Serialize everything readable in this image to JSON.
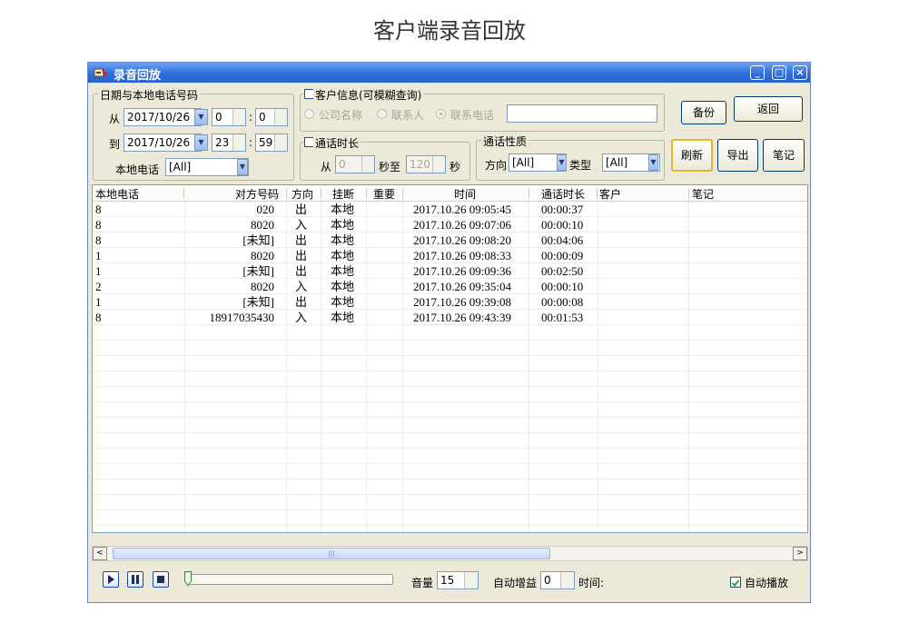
{
  "page_heading": "客户端录音回放",
  "window": {
    "title": "录音回放",
    "controls": {
      "minimize": "_",
      "maximize": "□",
      "close": "×"
    }
  },
  "date_group": {
    "legend": "日期与本地电话号码",
    "from_label": "从",
    "from_date": "2017/10/26 星",
    "from_hour": "0",
    "from_minute": "0",
    "to_label": "到",
    "to_date": "2017/10/26 星",
    "to_hour": "23",
    "to_minute": "59",
    "colon": ":",
    "local_phone_label": "本地电话",
    "local_phone_value": "[All]"
  },
  "customer_group": {
    "legend": "客户信息(可模糊查询)",
    "checked": false,
    "radio_company": "公司名称",
    "radio_contact": "联系人",
    "radio_phone": "联系电话",
    "selected_radio": "联系电话",
    "search_value": ""
  },
  "duration_group": {
    "legend": "通话时长",
    "checked": false,
    "from_label": "从",
    "from_value": "0",
    "mid_label": "秒至",
    "to_value": "120",
    "end_label": "秒"
  },
  "nature_group": {
    "legend": "通话性质",
    "direction_label": "方向",
    "direction_value": "[All]",
    "type_label": "类型",
    "type_value": "[All]"
  },
  "buttons": {
    "backup": "备份",
    "back": "返回",
    "refresh": "刷新",
    "export": "导出",
    "notes": "笔记"
  },
  "table": {
    "columns": [
      "本地电话",
      "对方号码",
      "方向",
      "挂断",
      "重要",
      "时间",
      "通话时长",
      "客户",
      "笔记"
    ],
    "rows": [
      {
        "local": "8",
        "remote": "020",
        "dir": "出",
        "hangup": "本地",
        "important": "",
        "time": "2017.10.26 09:05:45",
        "duration": "00:00:37",
        "customer": "",
        "note": ""
      },
      {
        "local": "8",
        "remote": "8020",
        "dir": "入",
        "hangup": "本地",
        "important": "",
        "time": "2017.10.26 09:07:06",
        "duration": "00:00:10",
        "customer": "",
        "note": ""
      },
      {
        "local": "8",
        "remote": "[未知]",
        "dir": "出",
        "hangup": "本地",
        "important": "",
        "time": "2017.10.26 09:08:20",
        "duration": "00:04:06",
        "customer": "",
        "note": ""
      },
      {
        "local": "1",
        "remote": "8020",
        "dir": "出",
        "hangup": "本地",
        "important": "",
        "time": "2017.10.26 09:08:33",
        "duration": "00:00:09",
        "customer": "",
        "note": ""
      },
      {
        "local": "1",
        "remote": "[未知]",
        "dir": "出",
        "hangup": "本地",
        "important": "",
        "time": "2017.10.26 09:09:36",
        "duration": "00:02:50",
        "customer": "",
        "note": ""
      },
      {
        "local": "2",
        "remote": "8020",
        "dir": "入",
        "hangup": "本地",
        "important": "",
        "time": "2017.10.26 09:35:04",
        "duration": "00:00:10",
        "customer": "",
        "note": ""
      },
      {
        "local": "1",
        "remote": "[未知]",
        "dir": "出",
        "hangup": "本地",
        "important": "",
        "time": "2017.10.26 09:39:08",
        "duration": "00:00:08",
        "customer": "",
        "note": ""
      },
      {
        "local": "8",
        "remote": "18917035430",
        "dir": "入",
        "hangup": "本地",
        "important": "",
        "time": "2017.10.26 09:43:39",
        "duration": "00:01:53",
        "customer": "",
        "note": ""
      }
    ]
  },
  "scrollbar": {
    "left": "<",
    "right": ">",
    "grip": "|||"
  },
  "player": {
    "volume_label": "音量",
    "volume_value": "15",
    "gain_label": "自动增益",
    "gain_value": "0",
    "time_label": "时间:",
    "autoplay_label": "自动播放",
    "autoplay_checked": true,
    "progress": 0
  },
  "colors": {
    "title_bar": "#2f6ed8",
    "window_bg": "#ece9d8",
    "focus_border": "#e9b22c"
  }
}
